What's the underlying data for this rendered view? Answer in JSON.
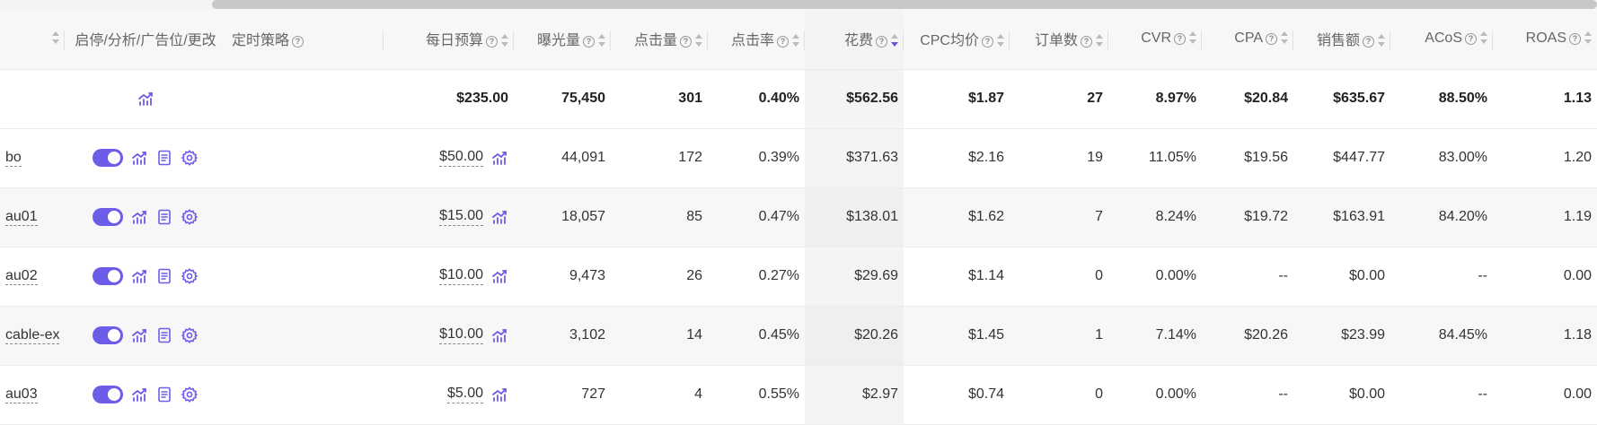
{
  "headers": {
    "name_col": "",
    "controls": "启停/分析/广告位/更改",
    "schedule": "定时策略",
    "budget": "每日预算",
    "impressions": "曝光量",
    "clicks": "点击量",
    "ctr": "点击率",
    "spend": "花费",
    "cpc": "CPC均价",
    "orders": "订单数",
    "cvr": "CVR",
    "cpa": "CPA",
    "sales": "销售额",
    "acos": "ACoS",
    "roas": "ROAS"
  },
  "help_glyph": "?",
  "summary": {
    "budget": "$235.00",
    "impressions": "75,450",
    "clicks": "301",
    "ctr": "0.40%",
    "spend": "$562.56",
    "cpc": "$1.87",
    "orders": "27",
    "cvr": "8.97%",
    "cpa": "$20.84",
    "sales": "$635.67",
    "acos": "88.50%",
    "roas": "1.13"
  },
  "rows": [
    {
      "name": "bo",
      "budget": "$50.00",
      "impressions": "44,091",
      "clicks": "172",
      "ctr": "0.39%",
      "spend": "$371.63",
      "cpc": "$2.16",
      "orders": "19",
      "cvr": "11.05%",
      "cpa": "$19.56",
      "sales": "$447.77",
      "acos": "83.00%",
      "roas": "1.20"
    },
    {
      "name": "au01",
      "budget": "$15.00",
      "impressions": "18,057",
      "clicks": "85",
      "ctr": "0.47%",
      "spend": "$138.01",
      "cpc": "$1.62",
      "orders": "7",
      "cvr": "8.24%",
      "cpa": "$19.72",
      "sales": "$163.91",
      "acos": "84.20%",
      "roas": "1.19"
    },
    {
      "name": "au02",
      "budget": "$10.00",
      "impressions": "9,473",
      "clicks": "26",
      "ctr": "0.27%",
      "spend": "$29.69",
      "cpc": "$1.14",
      "orders": "0",
      "cvr": "0.00%",
      "cpa": "--",
      "sales": "$0.00",
      "acos": "--",
      "roas": "0.00"
    },
    {
      "name": "cable-ex",
      "budget": "$10.00",
      "impressions": "3,102",
      "clicks": "14",
      "ctr": "0.45%",
      "spend": "$20.26",
      "cpc": "$1.45",
      "orders": "1",
      "cvr": "7.14%",
      "cpa": "$20.26",
      "sales": "$23.99",
      "acos": "84.45%",
      "roas": "1.18"
    },
    {
      "name": "au03",
      "budget": "$5.00",
      "impressions": "727",
      "clicks": "4",
      "ctr": "0.55%",
      "spend": "$2.97",
      "cpc": "$0.74",
      "orders": "0",
      "cvr": "0.00%",
      "cpa": "--",
      "sales": "$0.00",
      "acos": "--",
      "roas": "0.00"
    }
  ],
  "colors": {
    "accent": "#6c5ce7",
    "sort_active": "#5b56e0",
    "header_bg": "#f7f7f7",
    "row_alt_bg": "#f7f7f7"
  },
  "icons": {
    "toggle": "toggle-switch-on",
    "analysis": "trend-chart-icon",
    "placement": "document-list-icon",
    "settings": "gear-icon"
  }
}
